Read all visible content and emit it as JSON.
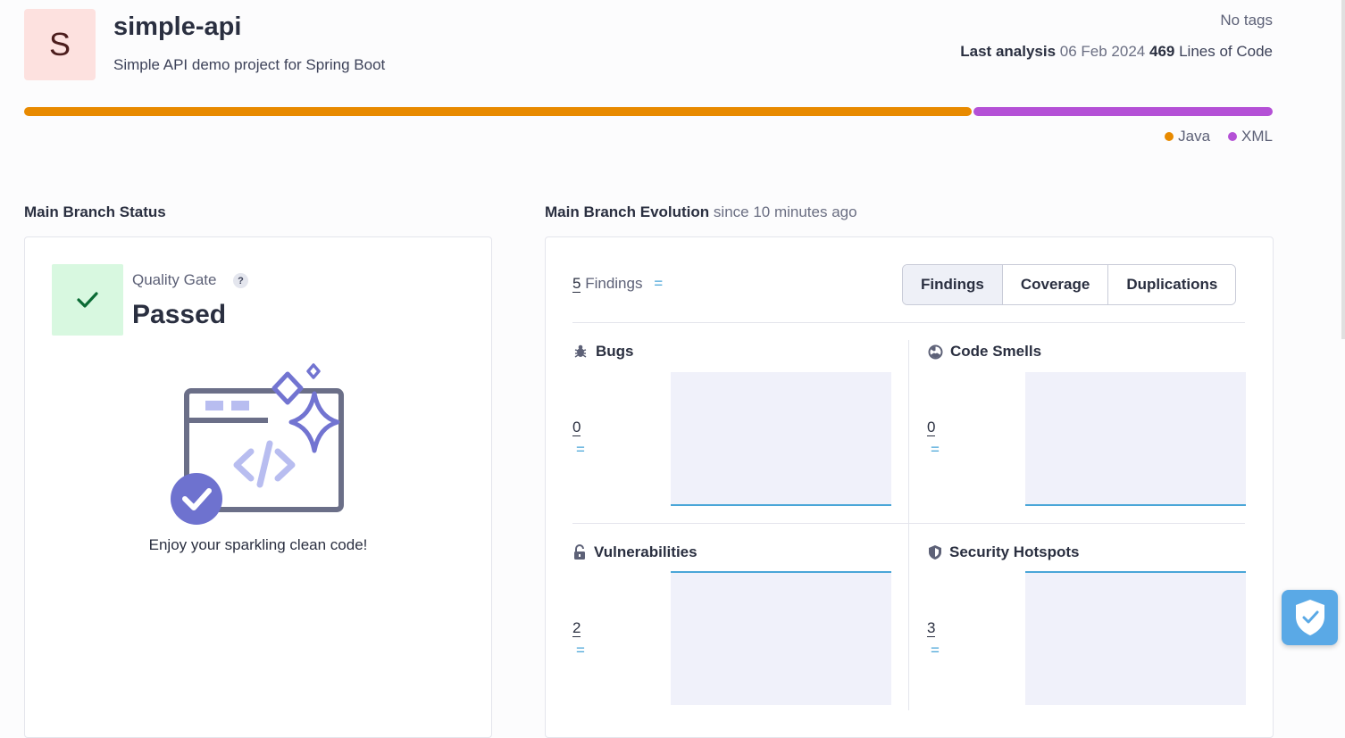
{
  "project": {
    "initial": "S",
    "name": "simple-api",
    "description": "Simple API demo project for Spring Boot",
    "tags": "No tags",
    "last_analysis_label": "Last analysis",
    "last_analysis_date": "06 Feb 2024",
    "loc_value": "469",
    "loc_label": "Lines of Code"
  },
  "languages": [
    {
      "name": "Java",
      "color": "#e88a00",
      "share": 0.76
    },
    {
      "name": "XML",
      "color": "#b450d6",
      "share": 0.24
    }
  ],
  "status": {
    "section_title": "Main Branch Status",
    "qg_label": "Quality Gate",
    "qg_help": "?",
    "qg_value": "Passed",
    "message": "Enjoy your sparkling clean code!"
  },
  "evolution": {
    "section_title": "Main Branch Evolution",
    "since": "since 10 minutes ago",
    "findings_count": "5",
    "findings_label": "Findings",
    "findings_trend": "=",
    "tabs": [
      "Findings",
      "Coverage",
      "Duplications"
    ],
    "metrics": [
      {
        "title": "Bugs",
        "value": "0",
        "trend": "=",
        "icon": "bug-icon"
      },
      {
        "title": "Code Smells",
        "value": "0",
        "trend": "=",
        "icon": "code-smell-icon"
      },
      {
        "title": "Vulnerabilities",
        "value": "2",
        "trend": "=",
        "icon": "lock-icon"
      },
      {
        "title": "Security Hotspots",
        "value": "3",
        "trend": "=",
        "icon": "shield-icon"
      }
    ]
  },
  "colors": {
    "accent": "#4aa6d8",
    "passed_bg": "#d8f8e0",
    "passed_check": "#0b6b35",
    "avatar_bg": "#fde1df"
  }
}
